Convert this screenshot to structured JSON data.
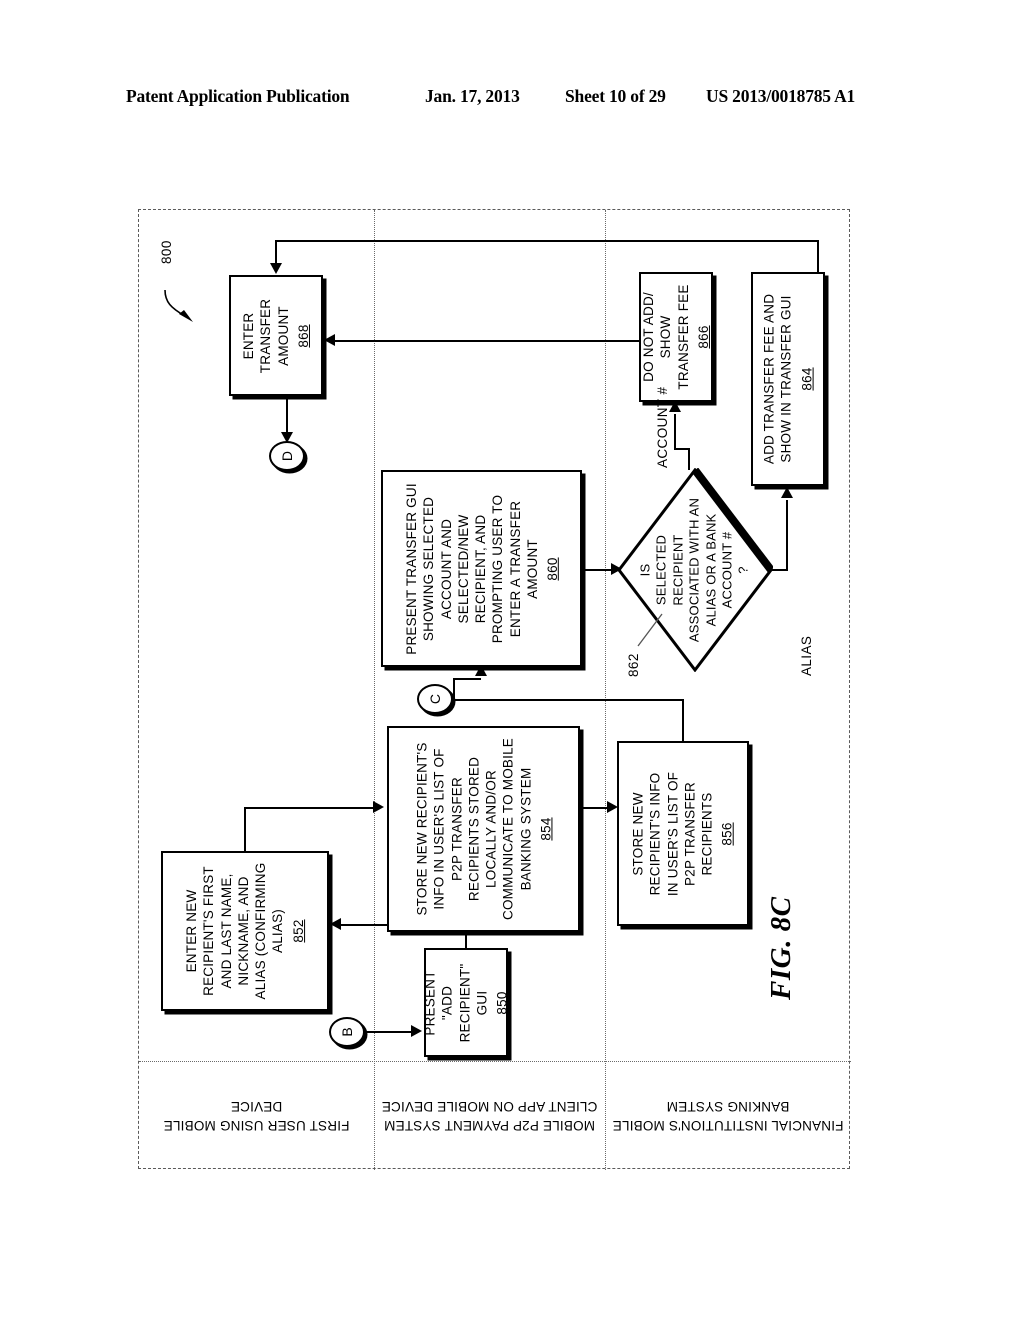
{
  "header": {
    "publication": "Patent Application Publication",
    "date": "Jan. 17, 2013",
    "sheet": "Sheet 10 of 29",
    "number": "US 2013/0018785 A1"
  },
  "figure": {
    "caption": "FIG. 8C",
    "reference_numeral": "800"
  },
  "lanes": [
    {
      "id": "lane-first-user",
      "label": "FIRST USER USING\nMOBILE DEVICE"
    },
    {
      "id": "lane-p2p-client-app",
      "label": "MOBILE P2P PAYMENT\nSYSTEM CLIENT APP ON\nMOBILE DEVICE"
    },
    {
      "id": "lane-mobile-banking-system",
      "label": "FINANCIAL INSTITUTION'S\nMOBILE BANKING\nSYSTEM"
    }
  ],
  "nodes": {
    "n850": {
      "text": "PRESENT\n\"ADD\nRECIPIENT\"\nGUI",
      "ref": "850",
      "shape": "process",
      "lane": "lane-p2p-client-app"
    },
    "n852": {
      "text": "ENTER NEW\nRECIPIENT'S FIRST\nAND LAST NAME,\nNICKNAME, AND\nALIAS (CONFIRMING\nALIAS)",
      "ref": "852",
      "shape": "process",
      "lane": "lane-first-user"
    },
    "n854": {
      "text": "STORE NEW RECIPIENT'S\nINFO IN USER'S LIST OF\nP2P TRANSFER\nRECIPIENTS STORED\nLOCALLY AND/OR\nCOMMUNICATE TO MOBILE\nBANKING SYSTEM",
      "ref": "854",
      "shape": "process",
      "lane": "lane-p2p-client-app"
    },
    "n856": {
      "text": "STORE NEW\nRECIPIENT'S INFO\nIN USER'S LIST OF\nP2P TRANSFER\nRECIPIENTS",
      "ref": "856",
      "shape": "process",
      "lane": "lane-mobile-banking-system"
    },
    "n860": {
      "text": "PRESENT TRANSFER GUI\nSHOWING SELECTED\nACCOUNT AND\nSELECTED/NEW\nRECIPIENT, AND\nPROMPTING USER TO\nENTER A TRANSFER\nAMOUNT",
      "ref": "860",
      "shape": "process",
      "lane": "lane-p2p-client-app"
    },
    "n862": {
      "text": "IS\nSELECTED\nRECIPIENT\nASSOCIATED WITH AN\nALIAS OR A BANK\nACCOUNT #\n?",
      "ref": "862",
      "shape": "decision",
      "lane": "lane-mobile-banking-system"
    },
    "n864": {
      "text": "ADD TRANSFER FEE AND\nSHOW IN TRANSFER GUI",
      "ref": "864",
      "shape": "process",
      "lane": "lane-mobile-banking-system"
    },
    "n866": {
      "text": "DO NOT ADD/\nSHOW\nTRANSFER FEE",
      "ref": "866",
      "shape": "process",
      "lane": "lane-mobile-banking-system"
    },
    "n868": {
      "text": "ENTER\nTRANSFER\nAMOUNT",
      "ref": "868",
      "shape": "process",
      "lane": "lane-first-user"
    }
  },
  "connectors": {
    "b": "B",
    "c": "C",
    "d": "D"
  },
  "edge_labels": {
    "account_number": "ACCOUNT #",
    "alias": "ALIAS"
  }
}
